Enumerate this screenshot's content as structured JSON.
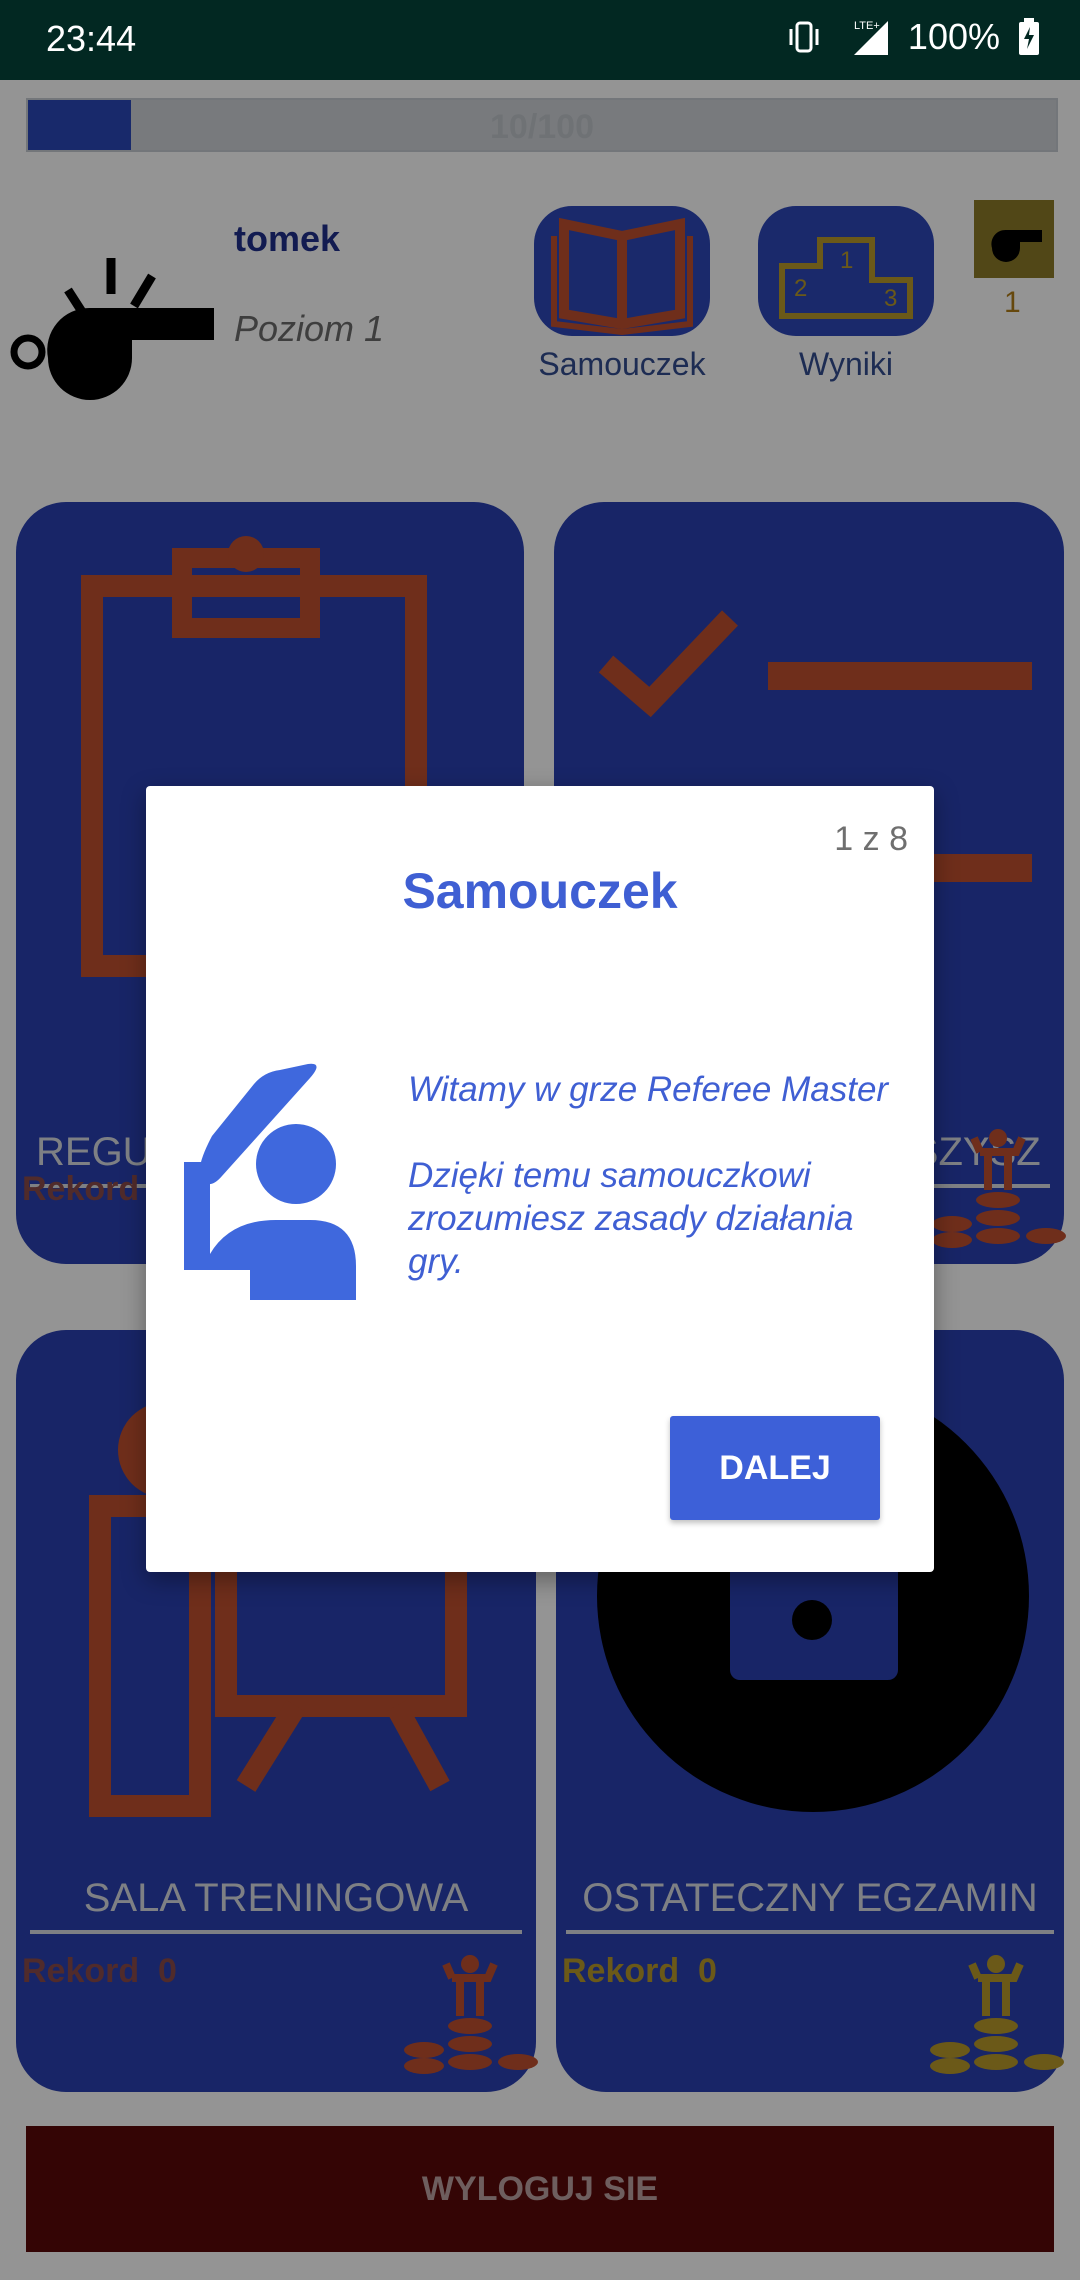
{
  "status_bar": {
    "time": "23:44",
    "battery": "100%",
    "network": "LTE+"
  },
  "progress": {
    "text": "10/100",
    "value": 0.1
  },
  "profile": {
    "username": "tomek",
    "level": "Poziom 1"
  },
  "top_buttons": {
    "tutorial": "Samouczek",
    "results": "Wyniki"
  },
  "coins": {
    "count": "1"
  },
  "cards": [
    {
      "label": "REGUŁY GRY",
      "record_label": "Rekord",
      "record_value": ""
    },
    {
      "label": "CZY DOBRZE SŁYSZYSZ?",
      "record_label": "",
      "record_value": ""
    },
    {
      "label": "SALA TRENINGOWA",
      "record_label": "Rekord",
      "record_value": "0"
    },
    {
      "label": "OSTATECZNY EGZAMIN",
      "record_label": "Rekord",
      "record_value": "0"
    }
  ],
  "logout_label": "WYLOGUJ SIE",
  "dialog": {
    "counter": "1 z 8",
    "title": "Samouczek",
    "line1": "Witamy w grze Referee Master",
    "line2": "Dzięki temu samouczkowi zrozumiesz zasady działania gry.",
    "next_button": "DALEJ"
  },
  "colors": {
    "card_blue": "#2a40b1",
    "accent_blue": "#3d60d8",
    "icon_red": "#c0502f",
    "gold": "#b99a2a",
    "logout_red": "#5a0a0a"
  }
}
